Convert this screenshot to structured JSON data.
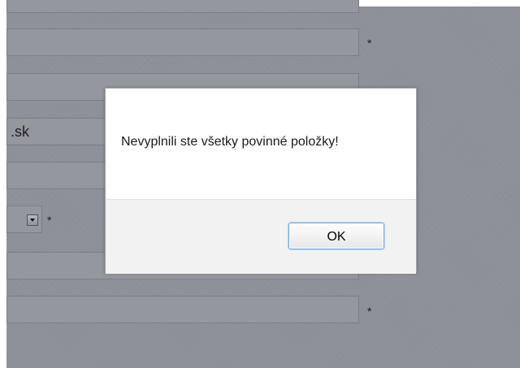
{
  "form": {
    "email_value": ".sk",
    "required_marker": "*"
  },
  "dialog": {
    "message": "Nevyplnili ste všetky povinné položky!",
    "ok_label": "OK"
  }
}
